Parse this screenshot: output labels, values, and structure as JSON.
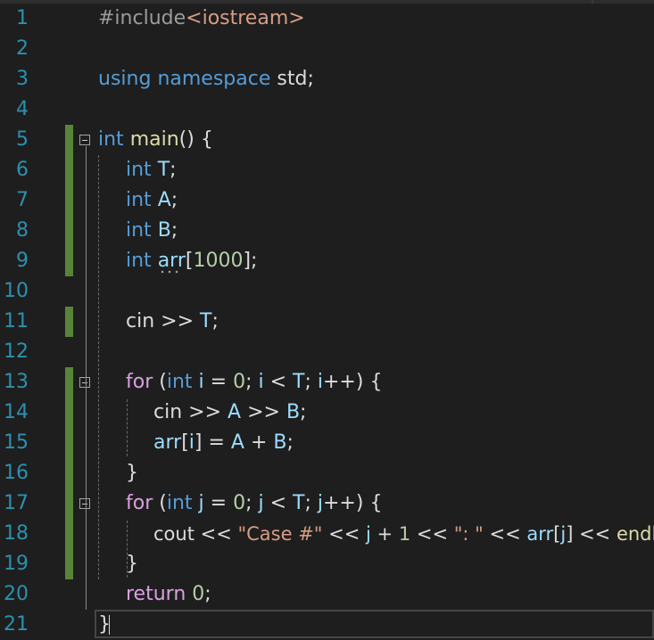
{
  "editor": {
    "language": "C++",
    "line_numbers": [
      "1",
      "2",
      "3",
      "4",
      "5",
      "6",
      "7",
      "8",
      "9",
      "10",
      "11",
      "12",
      "13",
      "14",
      "15",
      "16",
      "17",
      "18",
      "19",
      "20",
      "21"
    ],
    "code": {
      "l1": {
        "pp": "#include",
        "lt": "<",
        "lib": "iostream",
        "gt": ">"
      },
      "l3": {
        "kw1": "using",
        "kw2": "namespace",
        "name": "std",
        "semi": ";"
      },
      "l5": {
        "kw": "int",
        "fn": "main",
        "rest": "() {"
      },
      "l6": {
        "kw": "int",
        "var": "T",
        "semi": ";"
      },
      "l7": {
        "kw": "int",
        "var": "A",
        "semi": ";"
      },
      "l8": {
        "kw": "int",
        "var": "B",
        "semi": ";"
      },
      "l9": {
        "kw": "int",
        "var": "arr",
        "open": "[",
        "num": "1000",
        "close": "];"
      },
      "l11": {
        "obj": "cin",
        "op": " >> ",
        "var": "T",
        "semi": ";"
      },
      "l13": {
        "ctl": "for",
        "p1": " (",
        "kw": "int",
        "sp": " ",
        "v1": "i",
        "eq": " = ",
        "n0": "0",
        "s1": "; ",
        "v2": "i",
        "lt": " < ",
        "v3": "T",
        "s2": "; ",
        "v4": "i",
        "inc": "++) {"
      },
      "l14": {
        "obj": "cin",
        "op1": " >> ",
        "v1": "A",
        "op2": " >> ",
        "v2": "B",
        "semi": ";"
      },
      "l15": {
        "v1": "arr",
        "o": "[",
        "v2": "i",
        "c": "] = ",
        "v3": "A",
        "plus": " + ",
        "v4": "B",
        "semi": ";"
      },
      "l16": {
        "brace": "}"
      },
      "l17": {
        "ctl": "for",
        "p1": " (",
        "kw": "int",
        "sp": " ",
        "v1": "j",
        "eq": " = ",
        "n0": "0",
        "s1": "; ",
        "v2": "j",
        "lt": " < ",
        "v3": "T",
        "s2": "; ",
        "v4": "j",
        "inc": "++) {"
      },
      "l18": {
        "obj": "cout",
        "op1": " << ",
        "str": "\"Case #\"",
        "op2": " << ",
        "v1": "j",
        "plus": " + ",
        "n1": "1",
        "op3": " << ",
        "str2": "\": \"",
        "op4": " << ",
        "v2": "arr",
        "o": "[",
        "v3": "j",
        "c": "]",
        "op5": " << ",
        "endl": "endl",
        "semi": ";"
      },
      "l19": {
        "brace": "}"
      },
      "l20": {
        "ctl": "return",
        "sp": " ",
        "num": "0",
        "semi": ";"
      },
      "l21": {
        "brace": "}"
      }
    },
    "colors": {
      "background": "#1e1e1e",
      "line_number": "#2b91af",
      "keyword": "#569cd6",
      "control": "#d8a0df",
      "function": "#dcdcaa",
      "variable": "#9cdcfe",
      "number": "#b5cea8",
      "string": "#d69d85",
      "change_bar": "#57843a"
    }
  }
}
